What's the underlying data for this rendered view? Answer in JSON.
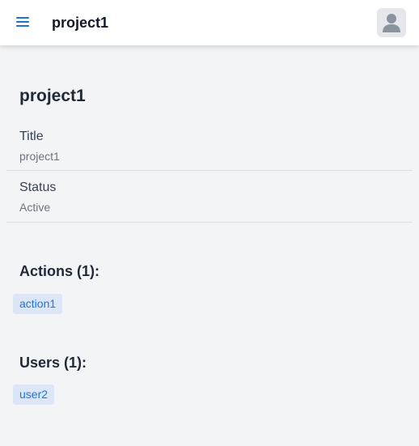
{
  "header": {
    "title": "project1",
    "menu_icon": "hamburger-menu-icon",
    "avatar_icon": "user-avatar-icon"
  },
  "project": {
    "heading": "project1",
    "fields": [
      {
        "label": "Title",
        "value": "project1"
      },
      {
        "label": "Status",
        "value": "Active"
      }
    ]
  },
  "actions": {
    "heading": "Actions (1):",
    "items": [
      "action1"
    ]
  },
  "users": {
    "heading": "Users (1):",
    "items": [
      "user2"
    ]
  },
  "colors": {
    "accent": "#1e73d6",
    "chip_bg": "#dbe7f7",
    "page_bg": "#f3f4f6"
  }
}
